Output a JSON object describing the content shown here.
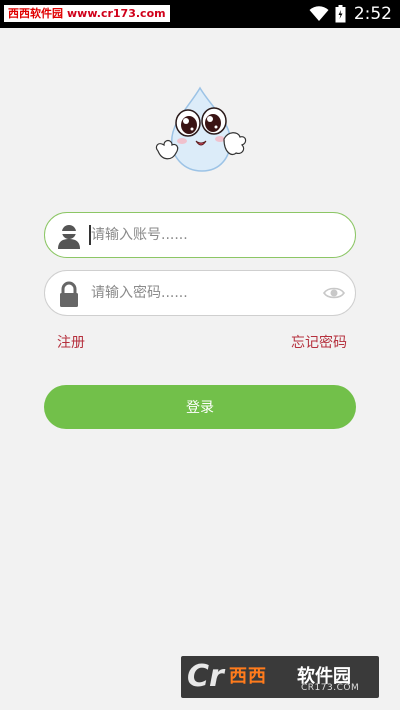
{
  "status_bar": {
    "watermark_site": "西西软件园",
    "watermark_url": "www.cr173.com",
    "time": "2:52",
    "icons": [
      "wifi-icon",
      "battery-icon"
    ]
  },
  "mascot": {
    "icon": "water-drop-mascot"
  },
  "form": {
    "username_placeholder": "请输入账号......",
    "password_placeholder": "请输入密码......",
    "username_icon": "user-icon",
    "password_icon": "lock-icon",
    "password_toggle_icon": "eye-icon"
  },
  "links": {
    "register": "注册",
    "forgot_password": "忘记密码"
  },
  "login_button": {
    "label": "登录"
  },
  "footer_watermark": {
    "logo_letter": "Cr",
    "brand": "西西",
    "suffix": "软件园",
    "domain": "CR173.COM"
  },
  "colors": {
    "background": "#f2f2f2",
    "accent_green": "#72c04a",
    "active_border": "#8cc665",
    "link_red": "#b5303d"
  }
}
